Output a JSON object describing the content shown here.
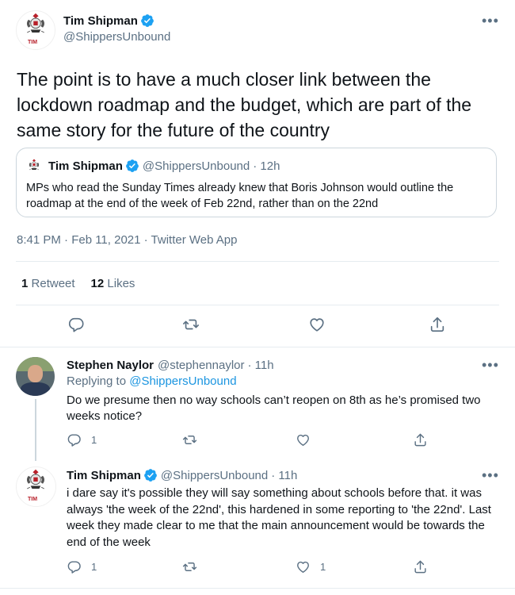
{
  "main_tweet": {
    "display_name": "Tim Shipman",
    "handle": "@ShippersUnbound",
    "text": "The point is to have a much closer link between the lockdown roadmap and the budget, which are part of the same story for the future of the country",
    "avatar_text": "TIM",
    "timestamp": "8:41 PM · Feb 11, 2021 · Twitter Web App",
    "retweets": "1",
    "retweets_label": "Retweet",
    "likes": "12",
    "likes_label": "Likes"
  },
  "quoted_tweet": {
    "display_name": "Tim Shipman",
    "handle": "@ShippersUnbound",
    "time": "· 12h",
    "text": "MPs who read the Sunday Times already knew that Boris Johnson would outline the roadmap at the end of the week of Feb 22nd, rather than on the 22nd"
  },
  "reply1": {
    "display_name": "Stephen Naylor",
    "handle": "@stephennaylor",
    "time": "· 11h",
    "replying_prefix": "Replying to",
    "replying_to": "@ShippersUnbound",
    "text": "Do we presume then no way schools can’t reopen on 8th as he’s promised two weeks notice?",
    "reply_count": "1"
  },
  "reply2": {
    "display_name": "Tim Shipman",
    "handle": "@ShippersUnbound",
    "time": "· 11h",
    "avatar_text": "TIM",
    "text": "i dare say it's possible they will say something about schools before that. it was always 'the week of the 22nd', this hardened in some reporting to 'the 22nd'. Last week they made clear to me that the main announcement would be towards the end of the week",
    "reply_count": "1",
    "like_count": "1"
  },
  "colors": {
    "accent": "#1da1f2",
    "text": "#0f1419",
    "muted": "#5b7083",
    "divider": "#e6ecf0"
  }
}
